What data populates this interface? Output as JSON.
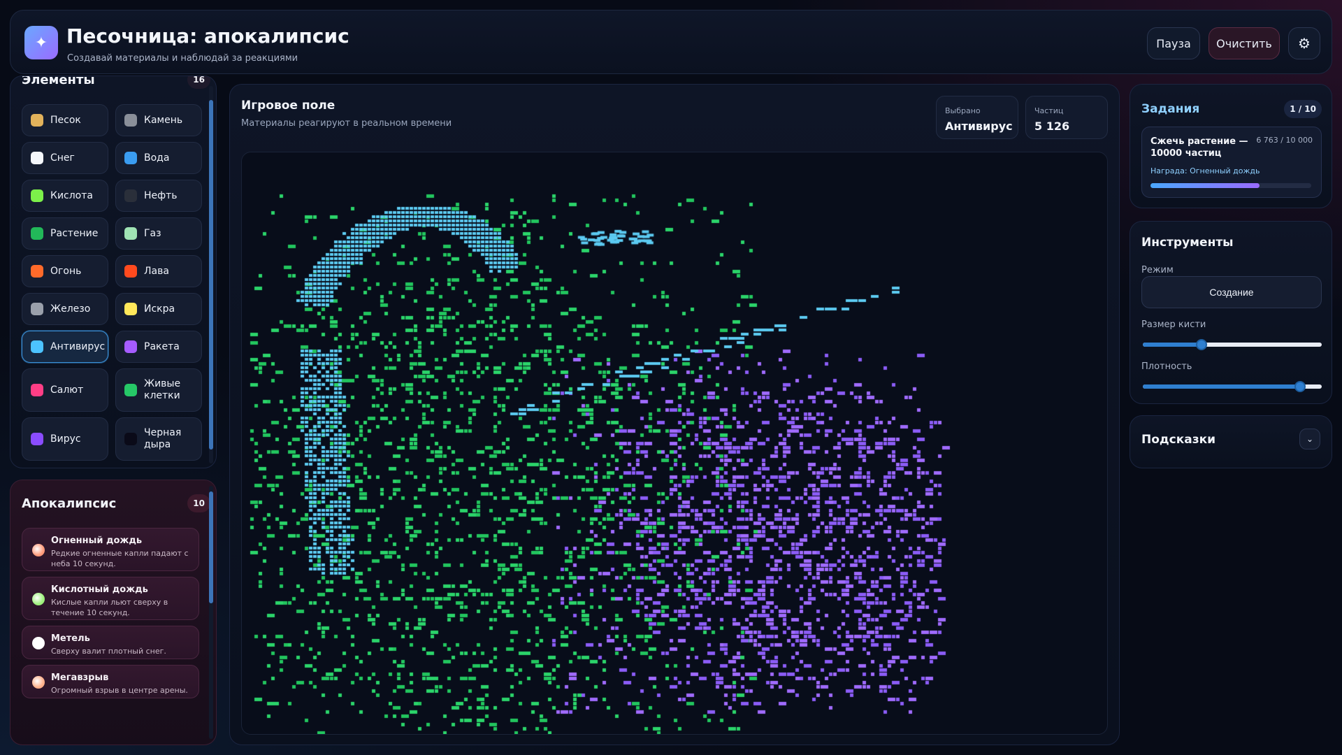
{
  "header": {
    "logo_icon": "sparkle-icon",
    "title": "Песочница: апокалипсис",
    "subtitle": "Создавай материалы и наблюдай за реакциями",
    "pause_label": "Пауза",
    "clear_label": "Очистить",
    "settings_icon": "gear-icon"
  },
  "elements": {
    "title": "Элементы",
    "count": "16",
    "items": [
      {
        "label": "Песок",
        "color": "#e2b25b"
      },
      {
        "label": "Камень",
        "color": "#8a8f99"
      },
      {
        "label": "Снег",
        "color": "#f4f7fb"
      },
      {
        "label": "Вода",
        "color": "#3a9cf0"
      },
      {
        "label": "Кислота",
        "color": "#7cf04a"
      },
      {
        "label": "Нефть",
        "color": "#2a2f3a"
      },
      {
        "label": "Растение",
        "color": "#22b859"
      },
      {
        "label": "Газ",
        "color": "#9fe3b4"
      },
      {
        "label": "Огонь",
        "color": "#ff6a2a"
      },
      {
        "label": "Лава",
        "color": "#ff4a1e"
      },
      {
        "label": "Железо",
        "color": "#9aa0ab"
      },
      {
        "label": "Искра",
        "color": "#ffe85a"
      },
      {
        "label": "Антивирус",
        "color": "#4cc3ff",
        "selected": true
      },
      {
        "label": "Ракета",
        "color": "#a65cff"
      },
      {
        "label": "Салют",
        "color": "#ff3e86"
      },
      {
        "label": "Живые клетки",
        "color": "#26c867"
      },
      {
        "label": "Вирус",
        "color": "#8a4cff"
      },
      {
        "label": "Черная дыра",
        "color": "#0a0a18"
      }
    ]
  },
  "apocalypse": {
    "title": "Апокалипсис",
    "count": "10",
    "events": [
      {
        "name": "Огненный дождь",
        "desc": "Редкие огненные капли падают с неба 10 секунд.",
        "color": "#ff9a7a"
      },
      {
        "name": "Кислотный дождь",
        "desc": "Кислые капли льют сверху в течение 10 секунд.",
        "color": "#9cf07a"
      },
      {
        "name": "Метель",
        "desc": "Сверху валит плотный снег.",
        "color": "#ffffff"
      },
      {
        "name": "Мегавзрыв",
        "desc": "Огромный взрыв в центре арены.",
        "color": "#ffb08a"
      }
    ]
  },
  "field": {
    "title": "Игровое поле",
    "subtitle": "Материалы реагируют в реальном времени",
    "selected_label": "Выбрано",
    "selected_value": "Антивирус",
    "particles_label": "Частиц",
    "particles_value": "5 126"
  },
  "quests": {
    "title": "Задания",
    "counter": "1 / 10",
    "current": {
      "name": "Сжечь растение — 10000 частиц",
      "progress_text": "6 763 / 10 000",
      "reward": "Награда: Огненный дождь",
      "progress": 0.6763
    }
  },
  "tools": {
    "title": "Инструменты",
    "mode_label": "Режим",
    "mode_value": "Создание",
    "brush_label": "Размер кисти",
    "brush_level": 0.33,
    "density_label": "Плотность",
    "density_level": 0.88
  },
  "hints": {
    "title": "Подсказки",
    "toggle_icon": "chevron-down-icon"
  }
}
